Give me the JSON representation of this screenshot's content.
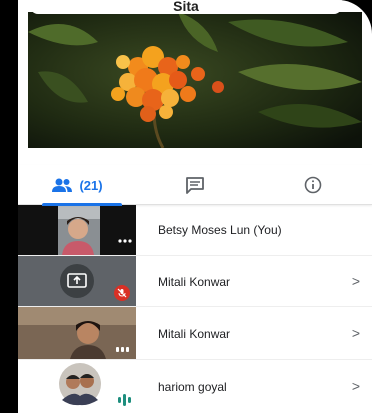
{
  "meeting": {
    "title": "Sita"
  },
  "tabs": {
    "people_count": "(21)",
    "people_icon": "people-icon",
    "chat_icon": "chat-icon",
    "info_icon": "info-icon"
  },
  "participants": [
    {
      "name": "Betsy Moses Lun (You)",
      "status": "speaking-dots"
    },
    {
      "name": "Mitali Konwar",
      "status": "muted",
      "sharing": true
    },
    {
      "name": "Mitali Konwar",
      "status": "speaking-dots"
    },
    {
      "name": "hariom goyal",
      "status": "audio-bars"
    }
  ],
  "colors": {
    "accent": "#1a73e8",
    "muted_badge": "#d93025",
    "active_teal": "#1e8e7e"
  }
}
